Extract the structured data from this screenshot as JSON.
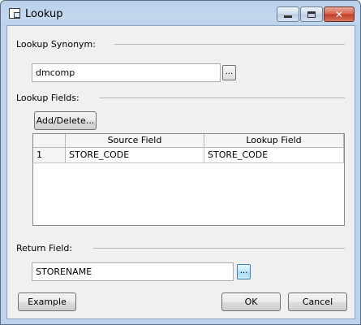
{
  "window": {
    "title": "Lookup"
  },
  "lookup_synonym": {
    "label": "Lookup Synonym:",
    "value": "dmcomp",
    "browse_label": "..."
  },
  "lookup_fields": {
    "label": "Lookup Fields:",
    "add_delete_label": "Add/Delete...",
    "columns": [
      "Source Field",
      "Lookup Field"
    ],
    "rows": [
      {
        "num": "1",
        "source": "STORE_CODE",
        "lookup": "STORE_CODE"
      }
    ]
  },
  "return_field": {
    "label": "Return Field:",
    "value": "STORENAME",
    "browse_label": "..."
  },
  "buttons": {
    "example": "Example",
    "ok": "OK",
    "cancel": "Cancel"
  },
  "icons": {
    "window_icon": "window-icon",
    "minimize": "minimize-icon",
    "maximize": "maximize-icon",
    "close": "close-icon"
  }
}
